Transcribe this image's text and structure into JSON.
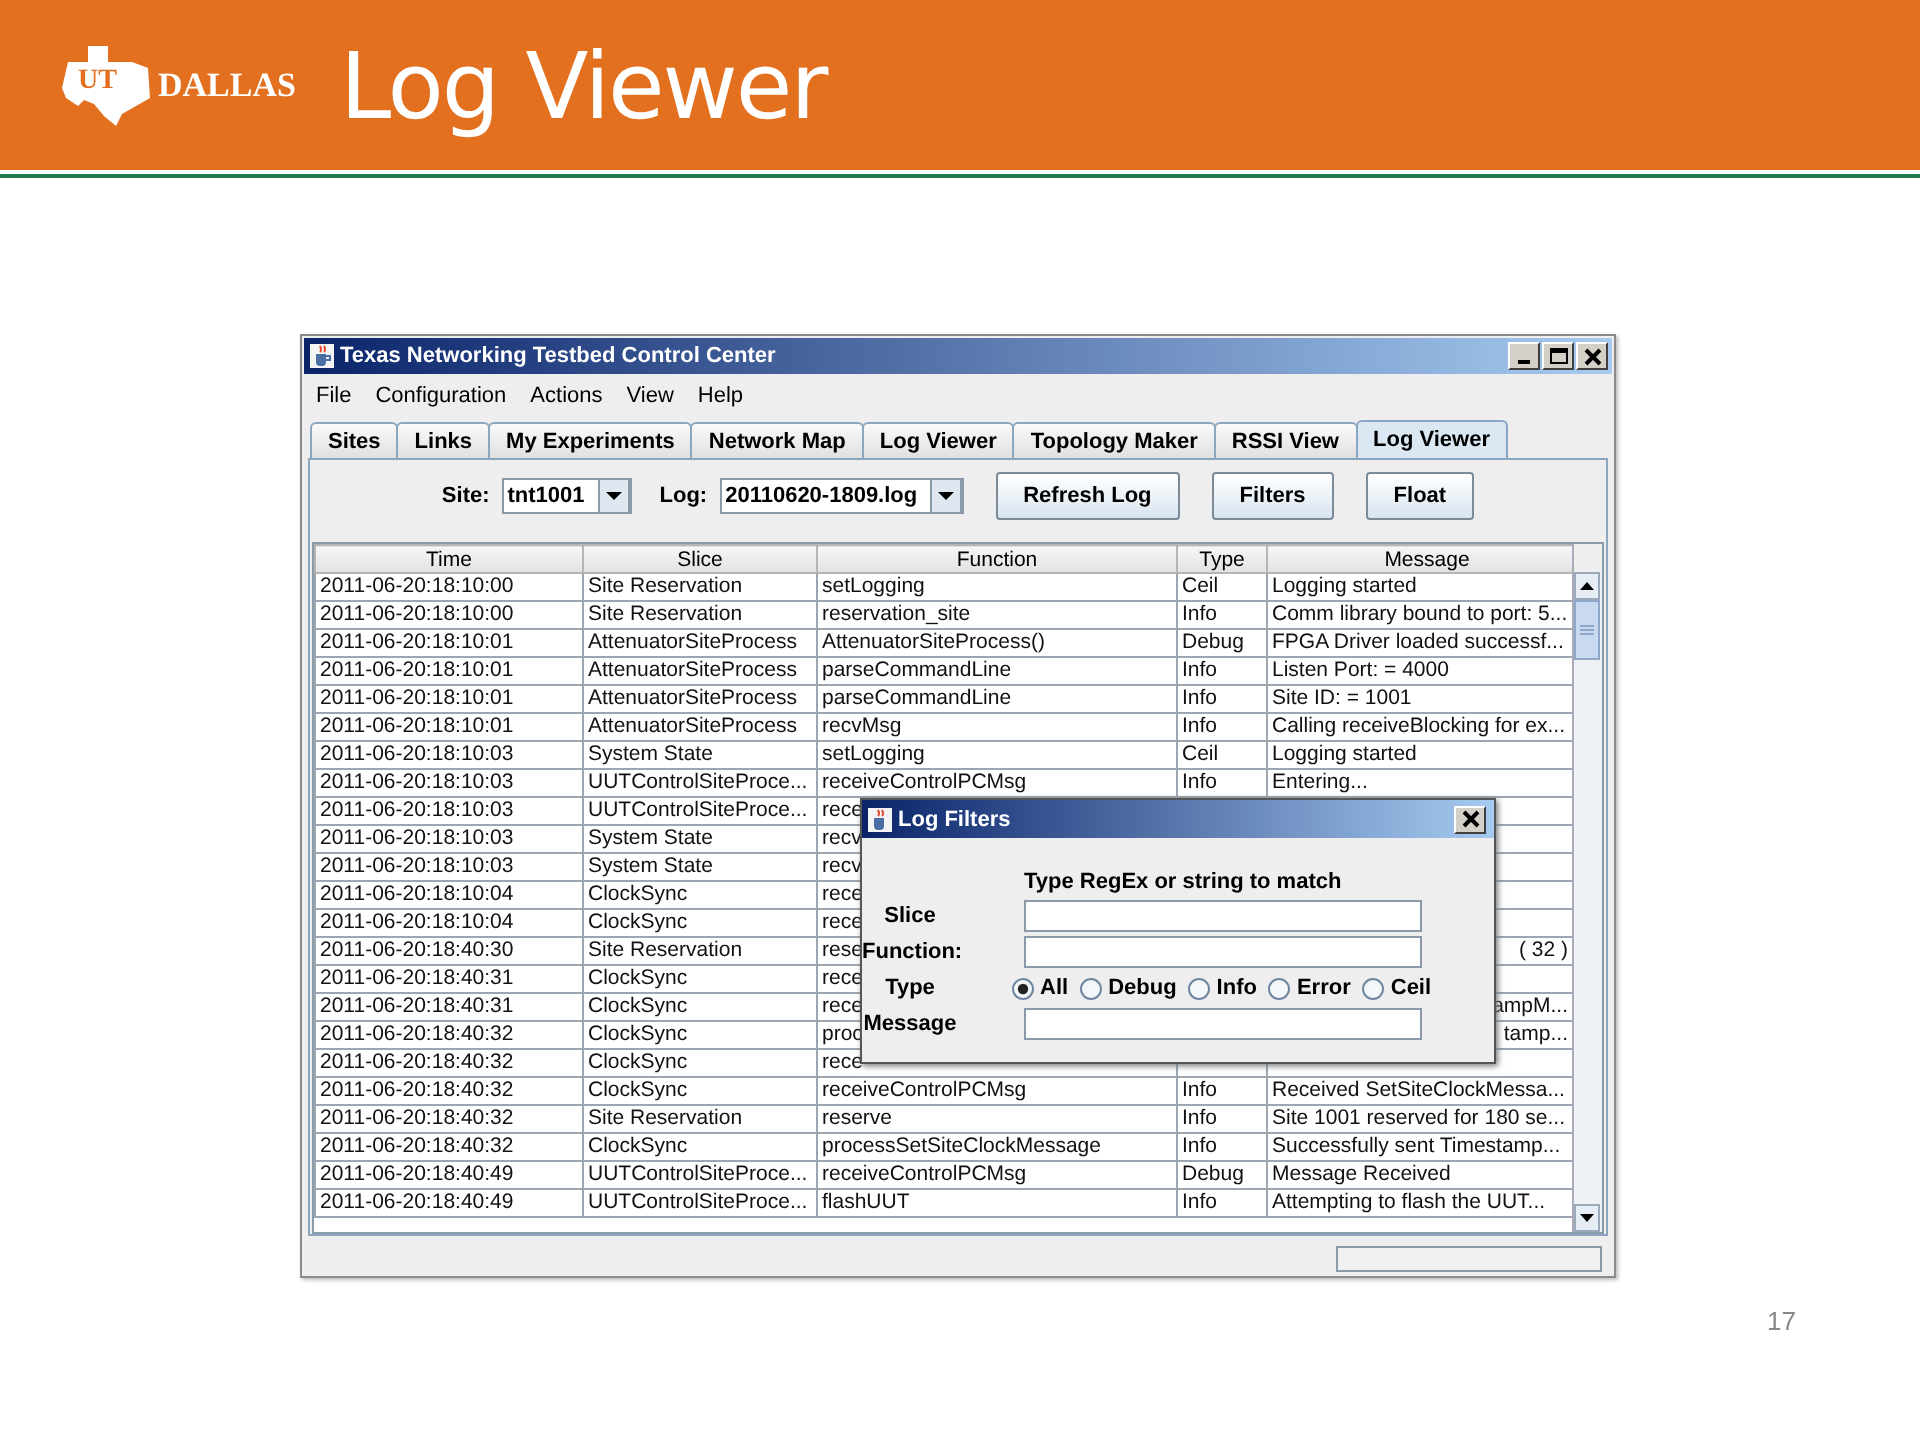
{
  "slide": {
    "logo": [
      "UT",
      "DALLAS"
    ],
    "title": "Log Viewer",
    "page_number": "17"
  },
  "window": {
    "title": "Texas Networking Testbed Control Center",
    "menu": [
      "File",
      "Configuration",
      "Actions",
      "View",
      "Help"
    ],
    "tabs": [
      {
        "label": "Sites",
        "selected": false
      },
      {
        "label": "Links",
        "selected": false
      },
      {
        "label": "My Experiments",
        "selected": false
      },
      {
        "label": "Network Map",
        "selected": false
      },
      {
        "label": "Log Viewer",
        "selected": false
      },
      {
        "label": "Topology Maker",
        "selected": false
      },
      {
        "label": "RSSI View",
        "selected": false
      },
      {
        "label": "Log Viewer",
        "selected": true
      }
    ],
    "toolbar": {
      "site_label": "Site:",
      "site_value": "tnt1001",
      "log_label": "Log:",
      "log_value": "20110620-1809.log",
      "buttons": [
        "Refresh Log",
        "Filters",
        "Float"
      ]
    },
    "table": {
      "columns": [
        "Time",
        "Slice",
        "Function",
        "Type",
        "Message"
      ],
      "rows": [
        {
          "time": "2011-06-20:18:10:00",
          "slice": "Site Reservation",
          "function": "setLogging",
          "type": "Ceil",
          "message": "Logging started"
        },
        {
          "time": "2011-06-20:18:10:00",
          "slice": "Site Reservation",
          "function": "reservation_site",
          "type": "Info",
          "message": "Comm library bound to port: 5..."
        },
        {
          "time": "2011-06-20:18:10:01",
          "slice": "AttenuatorSiteProcess",
          "function": "AttenuatorSiteProcess()",
          "type": "Debug",
          "message": "FPGA Driver loaded successf..."
        },
        {
          "time": "2011-06-20:18:10:01",
          "slice": "AttenuatorSiteProcess",
          "function": "parseCommandLine",
          "type": "Info",
          "message": "Listen Port: = 4000"
        },
        {
          "time": "2011-06-20:18:10:01",
          "slice": "AttenuatorSiteProcess",
          "function": "parseCommandLine",
          "type": "Info",
          "message": "Site ID: = 1001"
        },
        {
          "time": "2011-06-20:18:10:01",
          "slice": "AttenuatorSiteProcess",
          "function": "recvMsg",
          "type": "Info",
          "message": "Calling receiveBlocking for ex..."
        },
        {
          "time": "2011-06-20:18:10:03",
          "slice": "System State",
          "function": "setLogging",
          "type": "Ceil",
          "message": "Logging started"
        },
        {
          "time": "2011-06-20:18:10:03",
          "slice": "UUTControlSiteProce...",
          "function": "receiveControlPCMsg",
          "type": "Info",
          "message": "Entering..."
        },
        {
          "time": "2011-06-20:18:10:03",
          "slice": "UUTControlSiteProce...",
          "function": "rece"
        },
        {
          "time": "2011-06-20:18:10:03",
          "slice": "System State",
          "function": "recv"
        },
        {
          "time": "2011-06-20:18:10:03",
          "slice": "System State",
          "function": "recv"
        },
        {
          "time": "2011-06-20:18:10:04",
          "slice": "ClockSync",
          "function": "rece"
        },
        {
          "time": "2011-06-20:18:10:04",
          "slice": "ClockSync",
          "function": "rece"
        },
        {
          "time": "2011-06-20:18:40:30",
          "slice": "Site Reservation",
          "function": "rese",
          "message": "( 32 )"
        },
        {
          "time": "2011-06-20:18:40:31",
          "slice": "ClockSync",
          "function": "rece"
        },
        {
          "time": "2011-06-20:18:40:31",
          "slice": "ClockSync",
          "function": "rece",
          "message": "ampM..."
        },
        {
          "time": "2011-06-20:18:40:32",
          "slice": "ClockSync",
          "function": "proc",
          "message": "tamp..."
        },
        {
          "time": "2011-06-20:18:40:32",
          "slice": "ClockSync",
          "function": "rece"
        },
        {
          "time": "2011-06-20:18:40:32",
          "slice": "ClockSync",
          "function": "receiveControlPCMsg",
          "type": "Info",
          "message": "Received SetSiteClockMessa..."
        },
        {
          "time": "2011-06-20:18:40:32",
          "slice": "Site Reservation",
          "function": "reserve",
          "type": "Info",
          "message": "Site 1001 reserved for 180 se..."
        },
        {
          "time": "2011-06-20:18:40:32",
          "slice": "ClockSync",
          "function": "processSetSiteClockMessage",
          "type": "Info",
          "message": "Successfully sent Timestamp..."
        },
        {
          "time": "2011-06-20:18:40:49",
          "slice": "UUTControlSiteProce...",
          "function": "receiveControlPCMsg",
          "type": "Debug",
          "message": "Message Received"
        },
        {
          "time": "2011-06-20:18:40:49",
          "slice": "UUTControlSiteProce...",
          "function": "flashUUT",
          "type": "Info",
          "message": "Attempting to flash the UUT..."
        }
      ]
    },
    "dialog": {
      "title": "Log Filters",
      "heading": "Type RegEx or string to match",
      "fields": [
        {
          "label": "Slice",
          "kind": "text"
        },
        {
          "label": "Function:",
          "kind": "text"
        },
        {
          "label": "Type",
          "kind": "radio",
          "options": [
            {
              "label": "All",
              "selected": true
            },
            {
              "label": "Debug",
              "selected": false
            },
            {
              "label": "Info",
              "selected": false
            },
            {
              "label": "Error",
              "selected": false
            },
            {
              "label": "Ceil",
              "selected": false
            }
          ]
        },
        {
          "label": "Message",
          "kind": "text"
        }
      ]
    }
  }
}
